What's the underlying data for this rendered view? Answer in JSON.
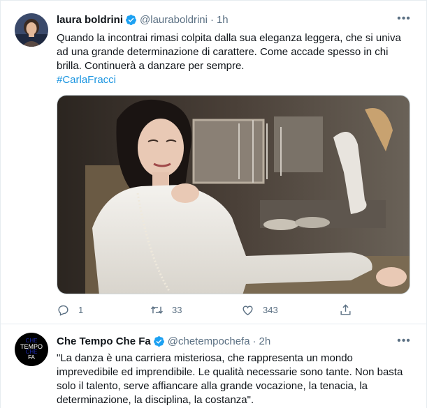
{
  "tweets": [
    {
      "display_name": "laura boldrini",
      "handle": "@lauraboldrini",
      "separator": "·",
      "time": "1h",
      "text_lines": [
        "Quando la incontrai rimasi colpita dalla sua eleganza leggera, che si univa",
        "ad una grande determinazione di carattere. Come accade spesso in chi",
        "brilla. Continuerà a danzare per sempre."
      ],
      "hashtag": "#CarlaFracci",
      "counts": {
        "reply": "1",
        "retweet": "33",
        "like": "343"
      }
    },
    {
      "display_name": "Che Tempo Che Fa",
      "handle": "@chetempochefa",
      "separator": "·",
      "time": "2h",
      "avatar_text": [
        "CHE",
        "TEMPO",
        "CHE",
        "FA"
      ],
      "text_lines": [
        "\"La danza è una carriera misteriosa, che rappresenta un mondo",
        "imprevedibile ed imprendibile. Le qualità necessarie sono tante. Non basta",
        "solo il talento, serve affiancare alla grande vocazione, la tenacia, la",
        "determinazione, la disciplina, la costanza\"."
      ]
    }
  ],
  "colors": {
    "verified": "#1da1f2",
    "hashtag": "#1b95e0",
    "secondary_text": "#5b7083",
    "divider": "#e6ecf0"
  },
  "icons": [
    "verified-badge-icon",
    "more-icon",
    "reply-icon",
    "retweet-icon",
    "like-icon",
    "share-icon"
  ]
}
